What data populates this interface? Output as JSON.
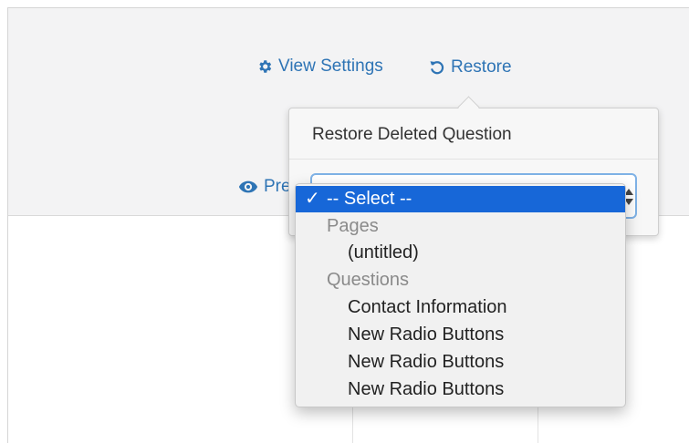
{
  "toolbar": {
    "view_settings": {
      "label": "View Settings",
      "icon": "gear-icon"
    },
    "restore": {
      "label": "Restore",
      "icon": "restore-icon"
    },
    "preview": {
      "label": "Pre",
      "icon": "eye-icon"
    }
  },
  "popover": {
    "title": "Restore Deleted Question"
  },
  "select": {
    "selected_value": "-- Select --",
    "options": [
      {
        "label": "-- Select --",
        "type": "option",
        "selected": true,
        "check": "✓"
      },
      {
        "label": "Pages",
        "type": "group"
      },
      {
        "label": "(untitled)",
        "type": "option"
      },
      {
        "label": "Questions",
        "type": "group"
      },
      {
        "label": "Contact Information",
        "type": "option"
      },
      {
        "label": "New Radio Buttons",
        "type": "option"
      },
      {
        "label": "New Radio Buttons",
        "type": "option"
      },
      {
        "label": "New Radio Buttons",
        "type": "option"
      }
    ]
  },
  "colors": {
    "link": "#2e74b5",
    "selected_bg": "#1767d8",
    "group_text": "#8a8a8a"
  }
}
